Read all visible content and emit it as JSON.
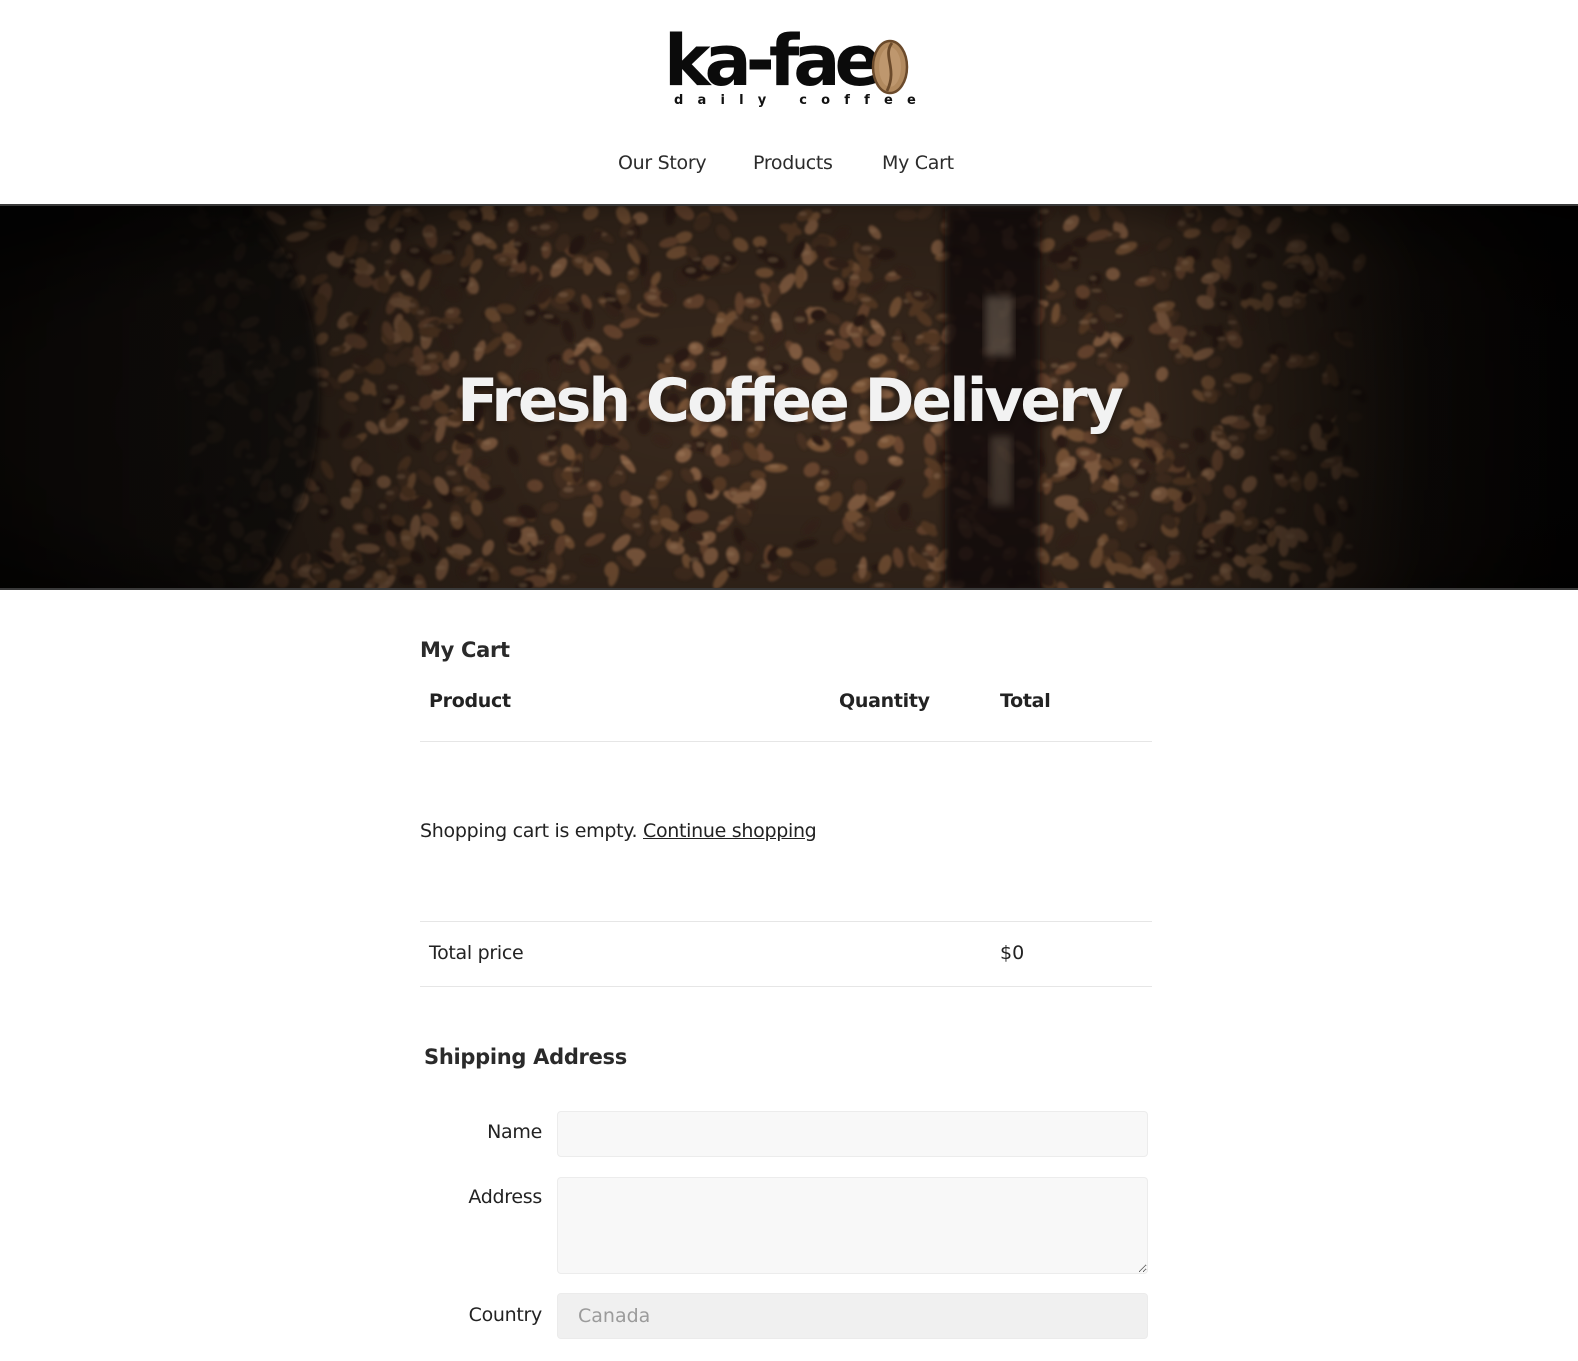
{
  "brand": {
    "name": "ka-fae",
    "tagline": "daily coffee",
    "accent_color": "#a8825a",
    "bean_icon": "coffee-bean-icon"
  },
  "nav": {
    "items": [
      {
        "label": "Our Story"
      },
      {
        "label": "Products"
      },
      {
        "label": "My Cart"
      }
    ]
  },
  "hero": {
    "title": "Fresh Coffee Delivery"
  },
  "cart": {
    "title": "My Cart",
    "columns": [
      "Product",
      "Quantity",
      "Total"
    ],
    "empty_message": "Shopping cart is empty.",
    "continue_link": "Continue shopping",
    "total_label": "Total price",
    "total_value": "$0"
  },
  "shipping": {
    "title": "Shipping Address",
    "name_label": "Name",
    "name_value": "",
    "address_label": "Address",
    "address_value": "",
    "country_label": "Country",
    "country_placeholder": "Canada"
  }
}
